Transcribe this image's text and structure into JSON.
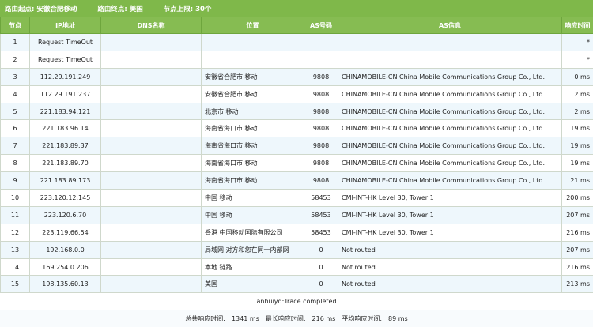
{
  "header": {
    "origin": "路由起点: 安徽合肥移动",
    "destination": "路由终点: 美国",
    "limit": "节点上限: 30个"
  },
  "columns": [
    "节点",
    "IP地址",
    "DNS名称",
    "位置",
    "AS号码",
    "AS信息",
    "响应时间"
  ],
  "rows": [
    {
      "hop": "1",
      "ip": "Request TimeOut",
      "dns": "",
      "location": "",
      "asn": "",
      "asinfo": "",
      "time": "*"
    },
    {
      "hop": "2",
      "ip": "Request TimeOut",
      "dns": "",
      "location": "",
      "asn": "",
      "asinfo": "",
      "time": "*"
    },
    {
      "hop": "3",
      "ip": "112.29.191.249",
      "dns": "",
      "location": "安徽省合肥市 移动",
      "asn": "9808",
      "asinfo": "CHINAMOBILE-CN China Mobile Communications Group Co., Ltd.",
      "time": "0 ms"
    },
    {
      "hop": "4",
      "ip": "112.29.191.237",
      "dns": "",
      "location": "安徽省合肥市 移动",
      "asn": "9808",
      "asinfo": "CHINAMOBILE-CN China Mobile Communications Group Co., Ltd.",
      "time": "2 ms"
    },
    {
      "hop": "5",
      "ip": "221.183.94.121",
      "dns": "",
      "location": "北京市 移动",
      "asn": "9808",
      "asinfo": "CHINAMOBILE-CN China Mobile Communications Group Co., Ltd.",
      "time": "2 ms"
    },
    {
      "hop": "6",
      "ip": "221.183.96.14",
      "dns": "",
      "location": "海南省海口市 移动",
      "asn": "9808",
      "asinfo": "CHINAMOBILE-CN China Mobile Communications Group Co., Ltd.",
      "time": "19 ms"
    },
    {
      "hop": "7",
      "ip": "221.183.89.37",
      "dns": "",
      "location": "海南省海口市 移动",
      "asn": "9808",
      "asinfo": "CHINAMOBILE-CN China Mobile Communications Group Co., Ltd.",
      "time": "19 ms"
    },
    {
      "hop": "8",
      "ip": "221.183.89.70",
      "dns": "",
      "location": "海南省海口市 移动",
      "asn": "9808",
      "asinfo": "CHINAMOBILE-CN China Mobile Communications Group Co., Ltd.",
      "time": "19 ms"
    },
    {
      "hop": "9",
      "ip": "221.183.89.173",
      "dns": "",
      "location": "海南省海口市 移动",
      "asn": "9808",
      "asinfo": "CHINAMOBILE-CN China Mobile Communications Group Co., Ltd.",
      "time": "21 ms"
    },
    {
      "hop": "10",
      "ip": "223.120.12.145",
      "dns": "",
      "location": "中国 移动",
      "asn": "58453",
      "asinfo": "CMI-INT-HK Level 30, Tower 1",
      "time": "200 ms"
    },
    {
      "hop": "11",
      "ip": "223.120.6.70",
      "dns": "",
      "location": "中国 移动",
      "asn": "58453",
      "asinfo": "CMI-INT-HK Level 30, Tower 1",
      "time": "207 ms"
    },
    {
      "hop": "12",
      "ip": "223.119.66.54",
      "dns": "",
      "location": "香港 中国移动国际有限公司",
      "asn": "58453",
      "asinfo": "CMI-INT-HK Level 30, Tower 1",
      "time": "216 ms"
    },
    {
      "hop": "13",
      "ip": "192.168.0.0",
      "dns": "",
      "location": "局域网 对方和您在同一内部网",
      "asn": "0",
      "asinfo": "Not routed",
      "time": "207 ms"
    },
    {
      "hop": "14",
      "ip": "169.254.0.206",
      "dns": "",
      "location": "本地 链路",
      "asn": "0",
      "asinfo": "Not routed",
      "time": "216 ms"
    },
    {
      "hop": "15",
      "ip": "198.135.60.13",
      "dns": "",
      "location": "美国",
      "asn": "0",
      "asinfo": "Not routed",
      "time": "213 ms"
    }
  ],
  "footer": {
    "status": "anhuiyd:Trace completed"
  },
  "summary": {
    "total_label": "总共响应时间:",
    "total_value": "1341 ms",
    "max_label": "最长响应时间:",
    "max_value": "216 ms",
    "avg_label": "平均响应时间:",
    "avg_value": "89 ms"
  },
  "colors": {
    "header_bg": "#7fb84a",
    "row_alt": "#eef7fc"
  }
}
